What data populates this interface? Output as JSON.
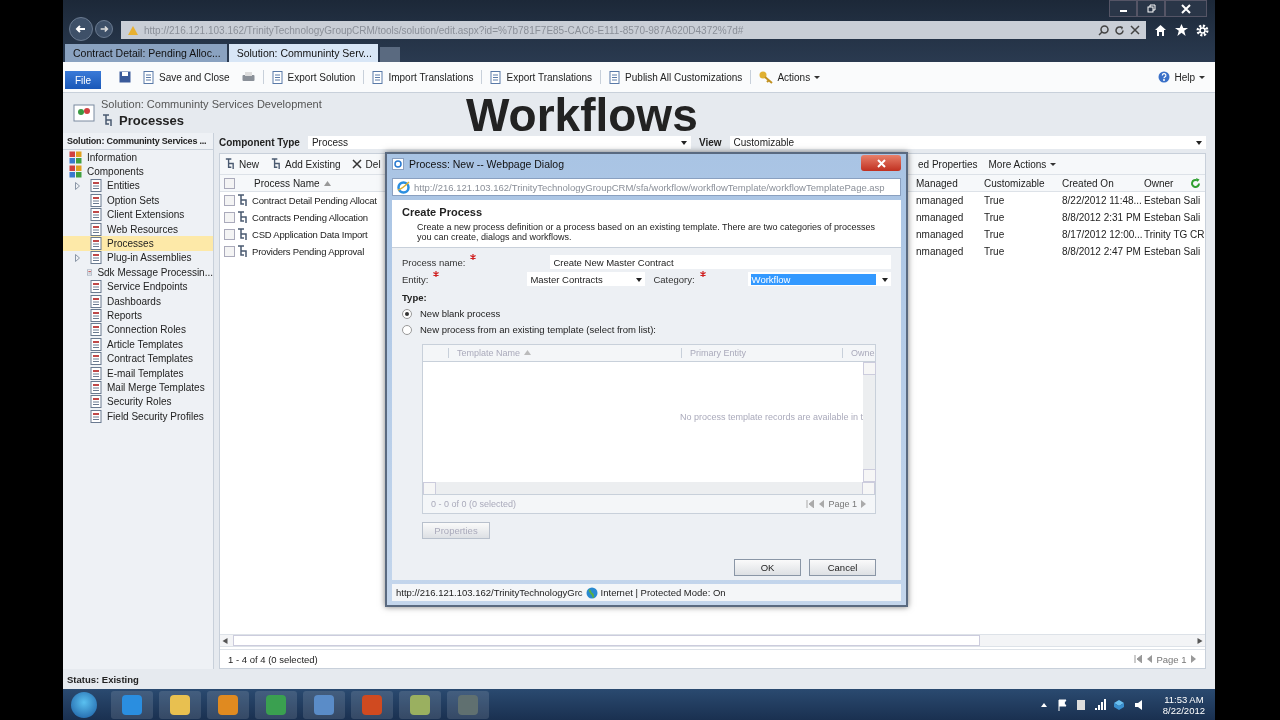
{
  "browser": {
    "address": "http://216.121.103.162/TrinityTechnologyGroupCRM/tools/solution/edit.aspx?id=%7b781F7E85-CAC6-E111-8570-987A620D4372%7d#",
    "tabs": [
      {
        "label": "Contract Detail: Pending Alloc...",
        "selected": false
      },
      {
        "label": "Solution: Communinty Serv...",
        "selected": true
      }
    ]
  },
  "ribbon": {
    "file": "File",
    "buttons": [
      "Save and Close",
      "Export Solution",
      "Import Translations",
      "Export Translations",
      "Publish All Customizations",
      "Actions"
    ],
    "help": "Help"
  },
  "header": {
    "solution": "Solution: Communinty Services Development",
    "title": "Processes",
    "overlay": "Workflows"
  },
  "sidebar": {
    "title": "Solution: Communinty Services ...",
    "items": [
      {
        "label": "Information",
        "selected": false
      },
      {
        "label": "Components",
        "selected": false,
        "children": [
          {
            "label": "Entities",
            "selected": false,
            "expandable": true
          },
          {
            "label": "Option Sets",
            "selected": false,
            "expandable": false
          },
          {
            "label": "Client Extensions",
            "selected": false,
            "expandable": false
          },
          {
            "label": "Web Resources",
            "selected": false,
            "expandable": false
          },
          {
            "label": "Processes",
            "selected": true,
            "expandable": false
          },
          {
            "label": "Plug-in Assemblies",
            "selected": false,
            "expandable": true
          },
          {
            "label": "Sdk Message Processin...",
            "selected": false,
            "expandable": false
          },
          {
            "label": "Service Endpoints",
            "selected": false,
            "expandable": false
          },
          {
            "label": "Dashboards",
            "selected": false,
            "expandable": false
          },
          {
            "label": "Reports",
            "selected": false,
            "expandable": false
          },
          {
            "label": "Connection Roles",
            "selected": false,
            "expandable": false
          },
          {
            "label": "Article Templates",
            "selected": false,
            "expandable": false
          },
          {
            "label": "Contract Templates",
            "selected": false,
            "expandable": false
          },
          {
            "label": "E-mail Templates",
            "selected": false,
            "expandable": false
          },
          {
            "label": "Mail Merge Templates",
            "selected": false,
            "expandable": false
          },
          {
            "label": "Security Roles",
            "selected": false,
            "expandable": false
          },
          {
            "label": "Field Security Profiles",
            "selected": false,
            "expandable": false
          }
        ]
      }
    ]
  },
  "filter": {
    "component_type_label": "Component Type",
    "component_type": "Process",
    "view_label": "View",
    "view": "Customizable"
  },
  "grid": {
    "toolbar_left": [
      "New",
      "Add Existing",
      "Del"
    ],
    "toolbar_right": [
      "ed Properties",
      "More Actions"
    ],
    "name_column": "Process Name",
    "select_all_checked": false,
    "columns": [
      "Managed",
      "Customizable",
      "Created On",
      "Owner"
    ],
    "rows": [
      {
        "name": "Contract Detail Pending Allocat",
        "checked": false,
        "cells": [
          "nmanaged",
          "True",
          "8/22/2012 11:48...",
          "Esteban Sali"
        ]
      },
      {
        "name": "Contracts Pending Allocation",
        "checked": false,
        "cells": [
          "nmanaged",
          "True",
          "8/8/2012 2:31 PM",
          "Esteban Sali"
        ]
      },
      {
        "name": "CSD Application Data Import",
        "checked": false,
        "cells": [
          "nmanaged",
          "True",
          "8/17/2012 12:00...",
          "Trinity TG CR"
        ]
      },
      {
        "name": "Providers Pending Approval",
        "checked": false,
        "cells": [
          "nmanaged",
          "True",
          "8/8/2012 2:47 PM",
          "Esteban Sali"
        ]
      }
    ],
    "count": "1 - 4 of 4 (0 selected)",
    "page": "Page 1"
  },
  "status": "Status: Existing",
  "dialog": {
    "title": "Process: New -- Webpage Dialog",
    "address": "http://216.121.103.162/TrinityTechnologyGroupCRM/sfa/workflow/workflowTemplate/workflowTemplatePage.asp",
    "heading": "Create Process",
    "description": "Create a new process definition or a process based on an existing template. There are two categories of processes you can create, dialogs and workflows.",
    "process_name_label": "Process name:",
    "process_name": "Create New Master Contract",
    "process_name_required": true,
    "entity_label": "Entity:",
    "entity": "Master Contracts",
    "entity_required": true,
    "category_label": "Category:",
    "category": "Workflow",
    "category_required": true,
    "type_label": "Type:",
    "types": [
      {
        "label": "New blank process",
        "selected": true
      },
      {
        "label": "New process from an existing template (select from list):",
        "selected": false
      }
    ],
    "template_columns": [
      "Template Name",
      "Primary Entity",
      "Owne"
    ],
    "empty": "No process template records are available in t",
    "template_count": "0 - 0 of 0 (0 selected)",
    "template_page": "Page 1",
    "properties": {
      "label": "Properties",
      "disabled": true
    },
    "ok": "OK",
    "cancel": "Cancel",
    "status_url": "http://216.121.103.162/TrinityTechnologyGrc",
    "status_zone": "Internet | Protected Mode: On"
  },
  "taskbar": {
    "time": "11:53 AM",
    "date": "8/22/2012"
  }
}
